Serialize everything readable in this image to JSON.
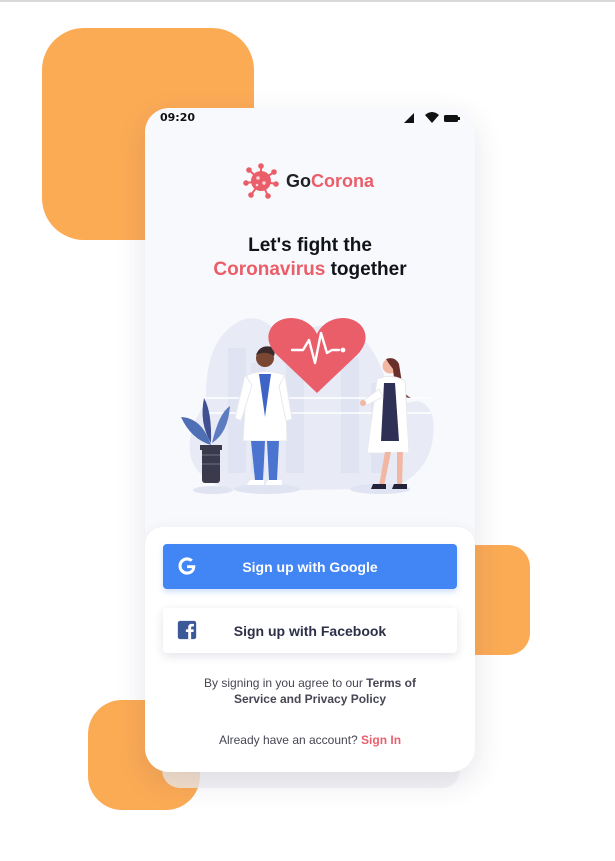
{
  "status_bar": {
    "time": "09:20",
    "icons": [
      "signal-icon",
      "wifi-icon",
      "battery-icon"
    ]
  },
  "logo": {
    "prefix": "Go",
    "suffix": "Corona",
    "icon": "virus-icon"
  },
  "headline": {
    "line1": "Let's fight the",
    "accent": "Coronavirus",
    "rest": " together"
  },
  "illustration": {
    "icon": "doctors-heart-illustration"
  },
  "actions": {
    "google_label": "Sign up with Google",
    "google_icon": "google-icon",
    "facebook_label": "Sign up with Facebook",
    "facebook_icon": "facebook-icon"
  },
  "legal": {
    "prefix": "By signing in you agree to our",
    "terms": "Terms of Service and Privacy Policy"
  },
  "signin": {
    "prompt": "Already have an account?",
    "link": "Sign In"
  },
  "colors": {
    "primary": "#4285F4",
    "accent": "#EA5E6A",
    "orange": "#FCAB55",
    "background": "#F8F9FC",
    "text_dark": "#11131A",
    "text_muted": "#464654"
  }
}
